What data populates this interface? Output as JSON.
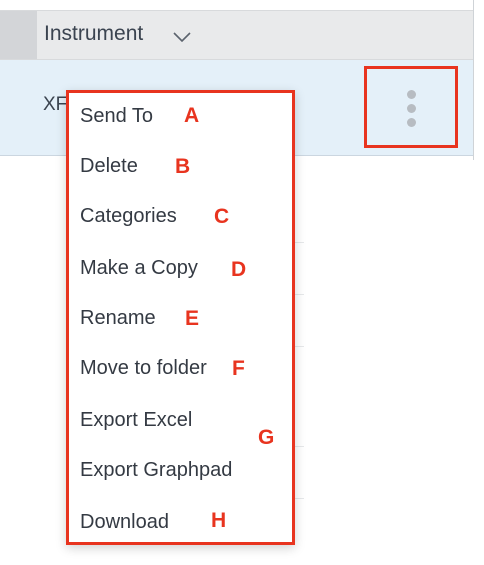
{
  "table": {
    "column_header": "Instrument",
    "row_text": "XF"
  },
  "menu": {
    "items": [
      {
        "label": "Send To",
        "annotation": "A"
      },
      {
        "label": "Delete",
        "annotation": "B"
      },
      {
        "label": "Categories",
        "annotation": "C"
      },
      {
        "label": "Make a Copy",
        "annotation": "D"
      },
      {
        "label": "Rename",
        "annotation": "E"
      },
      {
        "label": "Move to folder",
        "annotation": "F"
      },
      {
        "label": "Export Excel",
        "annotation": ""
      },
      {
        "label": "Export Graphpad",
        "annotation": ""
      },
      {
        "label": "Download",
        "annotation": "H"
      }
    ],
    "group_annotation": "G"
  },
  "colors": {
    "annotation_red": "#e8341f",
    "selected_row": "#e4f0f9",
    "header_bg": "#e9eaeb"
  }
}
